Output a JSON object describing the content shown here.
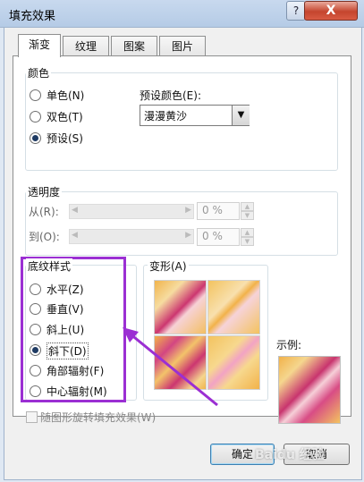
{
  "window": {
    "title": "填充效果",
    "help": "?",
    "close": "X"
  },
  "tabs": [
    "渐变",
    "纹理",
    "图案",
    "图片"
  ],
  "colors": {
    "title": "颜色",
    "options": [
      "单色(N)",
      "双色(T)",
      "预设(S)"
    ],
    "selected_index": 2,
    "preset_label": "预设颜色(E):",
    "preset_value": "漫漫黄沙"
  },
  "transparency": {
    "title": "透明度",
    "from_label": "从(R):",
    "to_label": "到(O):",
    "from_value": "0 %",
    "to_value": "0 %"
  },
  "shading": {
    "title": "底纹样式",
    "options": [
      "水平(Z)",
      "垂直(V)",
      "斜上(U)",
      "斜下(D)",
      "角部辐射(F)",
      "中心辐射(M)"
    ],
    "selected_index": 3
  },
  "variants": {
    "title": "变形(A)"
  },
  "sample": {
    "title": "示例:"
  },
  "rotate_checkbox": {
    "label": "随图形旋转填充效果(W)",
    "checked": false
  },
  "buttons": {
    "ok": "确定",
    "cancel": "取消"
  },
  "watermark": "Baidu 经验",
  "accent_colors": {
    "highlight_box": "#9b2fd3",
    "arrow": "#9b2fd3",
    "selection": "#1f3b63"
  }
}
